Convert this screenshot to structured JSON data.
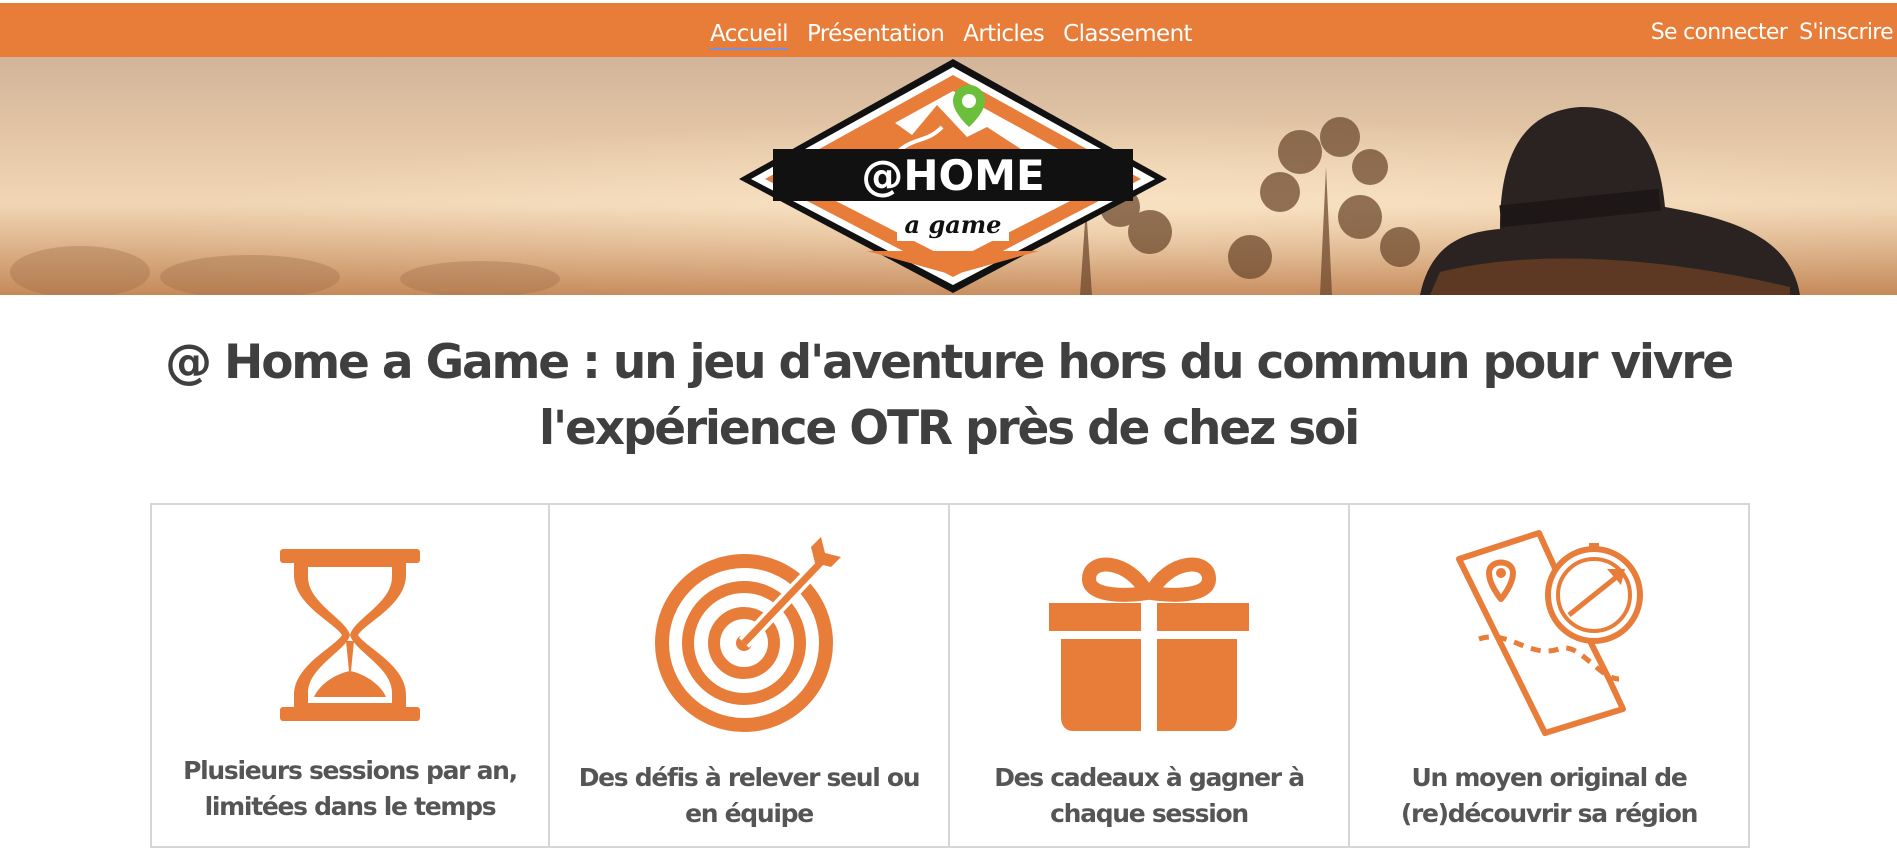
{
  "nav": {
    "items": [
      {
        "label": "Accueil",
        "active": true
      },
      {
        "label": "Présentation",
        "active": false
      },
      {
        "label": "Articles",
        "active": false
      },
      {
        "label": "Classement",
        "active": false
      }
    ]
  },
  "auth": {
    "login_label": "Se connecter",
    "signup_label": "S'inscrire"
  },
  "hero": {
    "logo_title": "@HOME",
    "logo_subtitle": "a game"
  },
  "headline": "@ Home a Game : un jeu d'aventure hors du commun pour vivre l'expérience OTR près de chez soi",
  "features": [
    {
      "icon": "hourglass-icon",
      "caption": "Plusieurs sessions par an, limitées dans le temps"
    },
    {
      "icon": "target-icon",
      "caption": "Des défis à relever seul ou en équipe"
    },
    {
      "icon": "gift-icon",
      "caption": "Des cadeaux à gagner à chaque session"
    },
    {
      "icon": "map-compass-icon",
      "caption": "Un moyen original de (re)découvrir sa région"
    }
  ],
  "colors": {
    "accent": "#e87d3a",
    "text_dark": "#3f3f3f",
    "card_border": "#d6d6d6"
  }
}
